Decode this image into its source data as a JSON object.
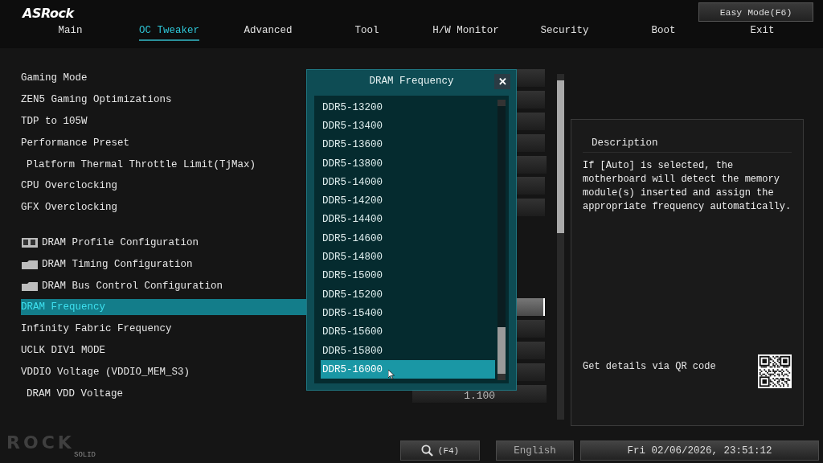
{
  "brand": {
    "logo": "ASRock",
    "footer_logo": "ROCK",
    "footer_logo_sub": "SOLID"
  },
  "easy_mode_button": "Easy Mode(F6)",
  "tabs": [
    {
      "label": "Main",
      "selected": false
    },
    {
      "label": "OC Tweaker",
      "selected": true
    },
    {
      "label": "Advanced",
      "selected": false
    },
    {
      "label": "Tool",
      "selected": false
    },
    {
      "label": "H/W Monitor",
      "selected": false
    },
    {
      "label": "Security",
      "selected": false
    },
    {
      "label": "Boot",
      "selected": false
    },
    {
      "label": "Exit",
      "selected": false
    }
  ],
  "settings": [
    {
      "kind": "setting",
      "label": "Gaming Mode",
      "indented": false,
      "selected": false
    },
    {
      "kind": "setting",
      "label": "ZEN5 Gaming Optimizations",
      "indented": false,
      "selected": false
    },
    {
      "kind": "setting",
      "label": "TDP to 105W",
      "indented": false,
      "selected": false
    },
    {
      "kind": "setting",
      "label": "Performance Preset",
      "indented": false,
      "selected": false
    },
    {
      "kind": "setting",
      "label": "Platform Thermal Throttle Limit(TjMax)",
      "indented": true,
      "selected": false
    },
    {
      "kind": "setting",
      "label": "CPU Overclocking",
      "indented": false,
      "selected": false
    },
    {
      "kind": "setting",
      "label": "GFX Overclocking",
      "indented": false,
      "selected": false
    },
    {
      "kind": "spacer"
    },
    {
      "kind": "memory-submenu",
      "label": "DRAM Profile Configuration",
      "indented": false,
      "selected": false
    },
    {
      "kind": "folder-submenu",
      "label": "DRAM Timing Configuration",
      "indented": false,
      "selected": false
    },
    {
      "kind": "folder-submenu",
      "label": "DRAM Bus Control Configuration",
      "indented": false,
      "selected": false
    },
    {
      "kind": "setting",
      "label": "DRAM Frequency",
      "indented": false,
      "selected": true
    },
    {
      "kind": "setting",
      "label": "Infinity Fabric Frequency",
      "indented": false,
      "selected": false
    },
    {
      "kind": "setting",
      "label": "UCLK DIV1 MODE",
      "indented": false,
      "selected": false
    },
    {
      "kind": "setting",
      "label": "VDDIO Voltage (VDDIO_MEM_S3)",
      "indented": false,
      "selected": false
    },
    {
      "kind": "setting",
      "label": "DRAM VDD Voltage",
      "indented": true,
      "selected": false,
      "value": "1.100"
    }
  ],
  "popup": {
    "title": "DRAM Frequency",
    "close": "✕",
    "options": [
      {
        "label": "DDR5-13200",
        "selected": false
      },
      {
        "label": "DDR5-13400",
        "selected": false
      },
      {
        "label": "DDR5-13600",
        "selected": false
      },
      {
        "label": "DDR5-13800",
        "selected": false
      },
      {
        "label": "DDR5-14000",
        "selected": false
      },
      {
        "label": "DDR5-14200",
        "selected": false
      },
      {
        "label": "DDR5-14400",
        "selected": false
      },
      {
        "label": "DDR5-14600",
        "selected": false
      },
      {
        "label": "DDR5-14800",
        "selected": false
      },
      {
        "label": "DDR5-15000",
        "selected": false
      },
      {
        "label": "DDR5-15200",
        "selected": false
      },
      {
        "label": "DDR5-15400",
        "selected": false
      },
      {
        "label": "DDR5-15600",
        "selected": false
      },
      {
        "label": "DDR5-15800",
        "selected": false
      },
      {
        "label": "DDR5-16000",
        "selected": true
      }
    ]
  },
  "description": {
    "title": "Description",
    "text": "If [Auto] is selected, the motherboard will detect the memory module(s) inserted and assign the appropriate frequency automatically.",
    "qr_label": "Get details via QR code"
  },
  "footer": {
    "search": "(F4)",
    "language": "English",
    "datetime": "Fri 02/06/2026, 23:51:12"
  }
}
